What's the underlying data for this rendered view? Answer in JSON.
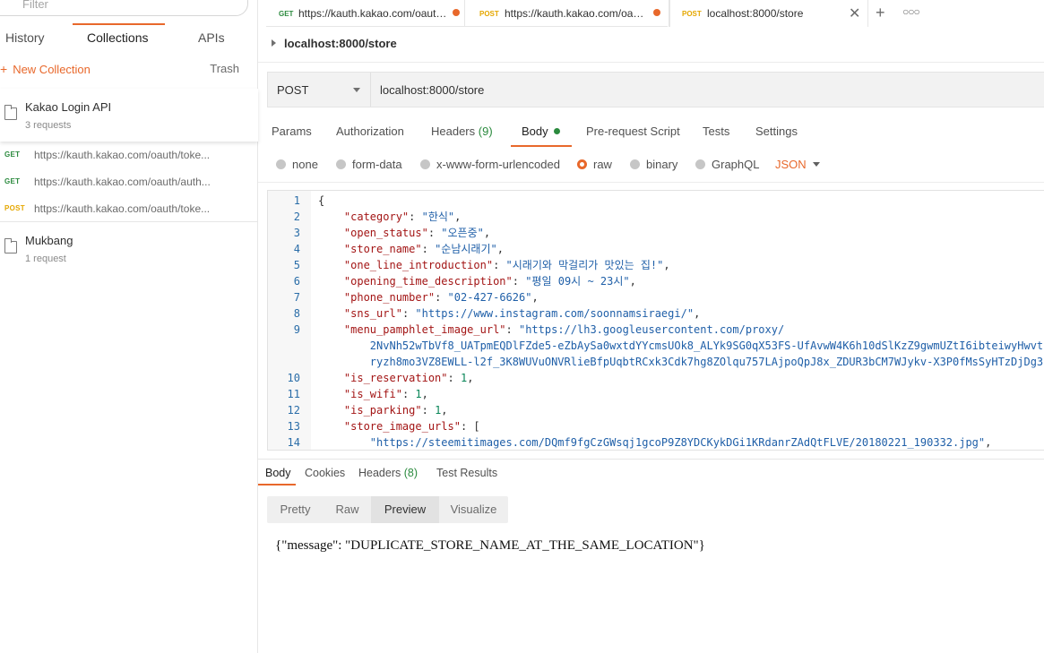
{
  "sidebar": {
    "filter_placeholder": "Filter",
    "tabs": [
      "History",
      "Collections",
      "APIs"
    ],
    "new_collection_label": "New Collection",
    "trash_label": "Trash",
    "collections": [
      {
        "name": "Kakao Login API",
        "count": "3 requests",
        "requests": [
          {
            "method": "GET",
            "url": "https://kauth.kakao.com/oauth/toke..."
          },
          {
            "method": "GET",
            "url": "https://kauth.kakao.com/oauth/auth..."
          },
          {
            "method": "POST",
            "url": "https://kauth.kakao.com/oauth/toke..."
          }
        ]
      },
      {
        "name": "Mukbang",
        "count": "1 request"
      }
    ]
  },
  "tabs": [
    {
      "method": "GET",
      "title": "https://kauth.kakao.com/oauth..."
    },
    {
      "method": "POST",
      "title": "https://kauth.kakao.com/oaut..."
    },
    {
      "method": "POST",
      "title": "localhost:8000/store"
    }
  ],
  "breadcrumb": "localhost:8000/store",
  "request": {
    "method": "POST",
    "url": "localhost:8000/store",
    "tabs": {
      "params": "Params",
      "authorization": "Authorization",
      "headers": "Headers",
      "headers_count": "(9)",
      "body": "Body",
      "pre_request": "Pre-request Script",
      "tests": "Tests",
      "settings": "Settings"
    },
    "body_types": [
      "none",
      "form-data",
      "x-www-form-urlencoded",
      "raw",
      "binary",
      "GraphQL"
    ],
    "format": "JSON"
  },
  "code": {
    "line_numbers": [
      "1",
      "2",
      "3",
      "4",
      "5",
      "6",
      "7",
      "8",
      "9",
      "",
      "",
      "10",
      "11",
      "12",
      "13",
      "14"
    ],
    "lines": [
      "{",
      "    \"category\": \"한식\",",
      "    \"open_status\": \"오픈중\",",
      "    \"store_name\": \"순남시래기\",",
      "    \"one_line_introduction\": \"시래기와 막걸리가 맛있는 집!\",",
      "    \"opening_time_description\": \"평일 09시 ~ 23시\",",
      "    \"phone_number\": \"02-427-6626\",",
      "    \"sns_url\": \"https://www.instagram.com/soonnamsiraegi/\",",
      "    \"menu_pamphlet_image_url\": \"https://lh3.googleusercontent.com/proxy/",
      "        2NvNh52wTbVf8_UATpmEQDlFZde5-eZbAySa0wxtdYYcmsUOk8_ALYk9SG0qX53FS-UfAvwW4K6h10dSlKzZ9gwmUZtI6ibteiwyHwvt",
      "        ryzh8mo3VZ8EWLL-l2f_3K8WUVuONVRlieBfpUqbtRCxk3Cdk7hg8ZOlqu757LAjpoQpJ8x_ZDUR3bCM7WJykv-X3P0fMsSyHTzDjDg3",
      "    \"is_reservation\": 1,",
      "    \"is_wifi\": 1,",
      "    \"is_parking\": 1,",
      "    \"store_image_urls\": [",
      "        \"https://steemitimages.com/DQmf9fgCzGWsqj1gcoP9Z8YDCKykDGi1KRdanrZAdQtFLVE/20180221_190332.jpg\","
    ]
  },
  "response": {
    "tabs": {
      "body": "Body",
      "cookies": "Cookies",
      "headers": "Headers",
      "headers_count": "(8)",
      "test_results": "Test Results"
    },
    "view_modes": [
      "Pretty",
      "Raw",
      "Preview",
      "Visualize"
    ],
    "active_view": "Preview",
    "preview_text": "{\"message\": \"DUPLICATE_STORE_NAME_AT_THE_SAME_LOCATION\"}"
  },
  "colors": {
    "accent": "#e8682b",
    "get": "#2b8a3e",
    "post": "#e5a700"
  }
}
